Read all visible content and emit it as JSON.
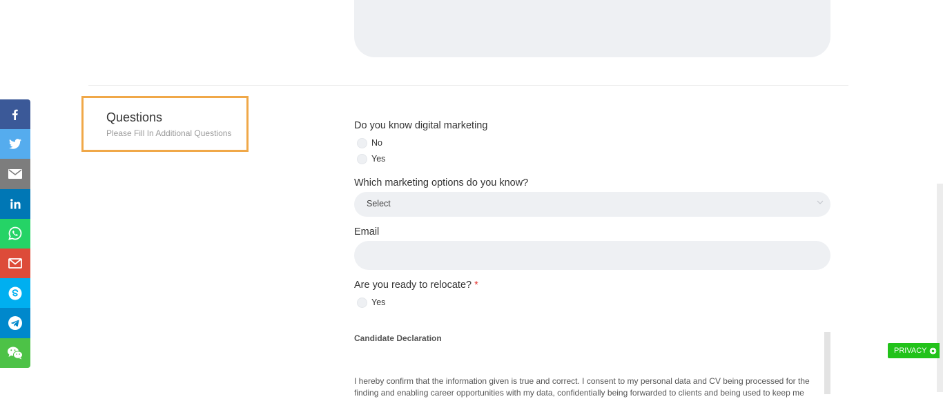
{
  "section": {
    "title": "Questions",
    "subtitle": "Please Fill In Additional Questions"
  },
  "questions": {
    "q1": {
      "label": "Do you know digital marketing",
      "options": [
        "No",
        "Yes"
      ]
    },
    "q2": {
      "label": "Which marketing options do you know?",
      "select_value": "Select"
    },
    "q3": {
      "label": "Email",
      "value": ""
    },
    "q4": {
      "label": "Are you ready to relocate?",
      "required_mark": "*",
      "options": [
        "Yes"
      ]
    }
  },
  "declaration": {
    "title": "Candidate Declaration",
    "text": "I hereby confirm that the information given is true and correct. I consent to my personal data and CV being processed for the finding and enabling career opportunities with my data, confidentially being forwarded to clients and being used to keep me"
  },
  "share": {
    "items": [
      {
        "icon": "facebook-icon",
        "color": "#3b5998"
      },
      {
        "icon": "twitter-icon",
        "color": "#55acee"
      },
      {
        "icon": "email-icon",
        "color": "#7d7d7d"
      },
      {
        "icon": "linkedin-icon",
        "color": "#0077b5"
      },
      {
        "icon": "whatsapp-icon",
        "color": "#25d366"
      },
      {
        "icon": "gmail-icon",
        "color": "#dd4b39"
      },
      {
        "icon": "skype-icon",
        "color": "#00aff0"
      },
      {
        "icon": "telegram-icon",
        "color": "#0088cc"
      },
      {
        "icon": "wechat-icon",
        "color": "#4dc247"
      }
    ]
  },
  "privacy": {
    "label": "PRIVACY",
    "icon": "gear-icon"
  }
}
